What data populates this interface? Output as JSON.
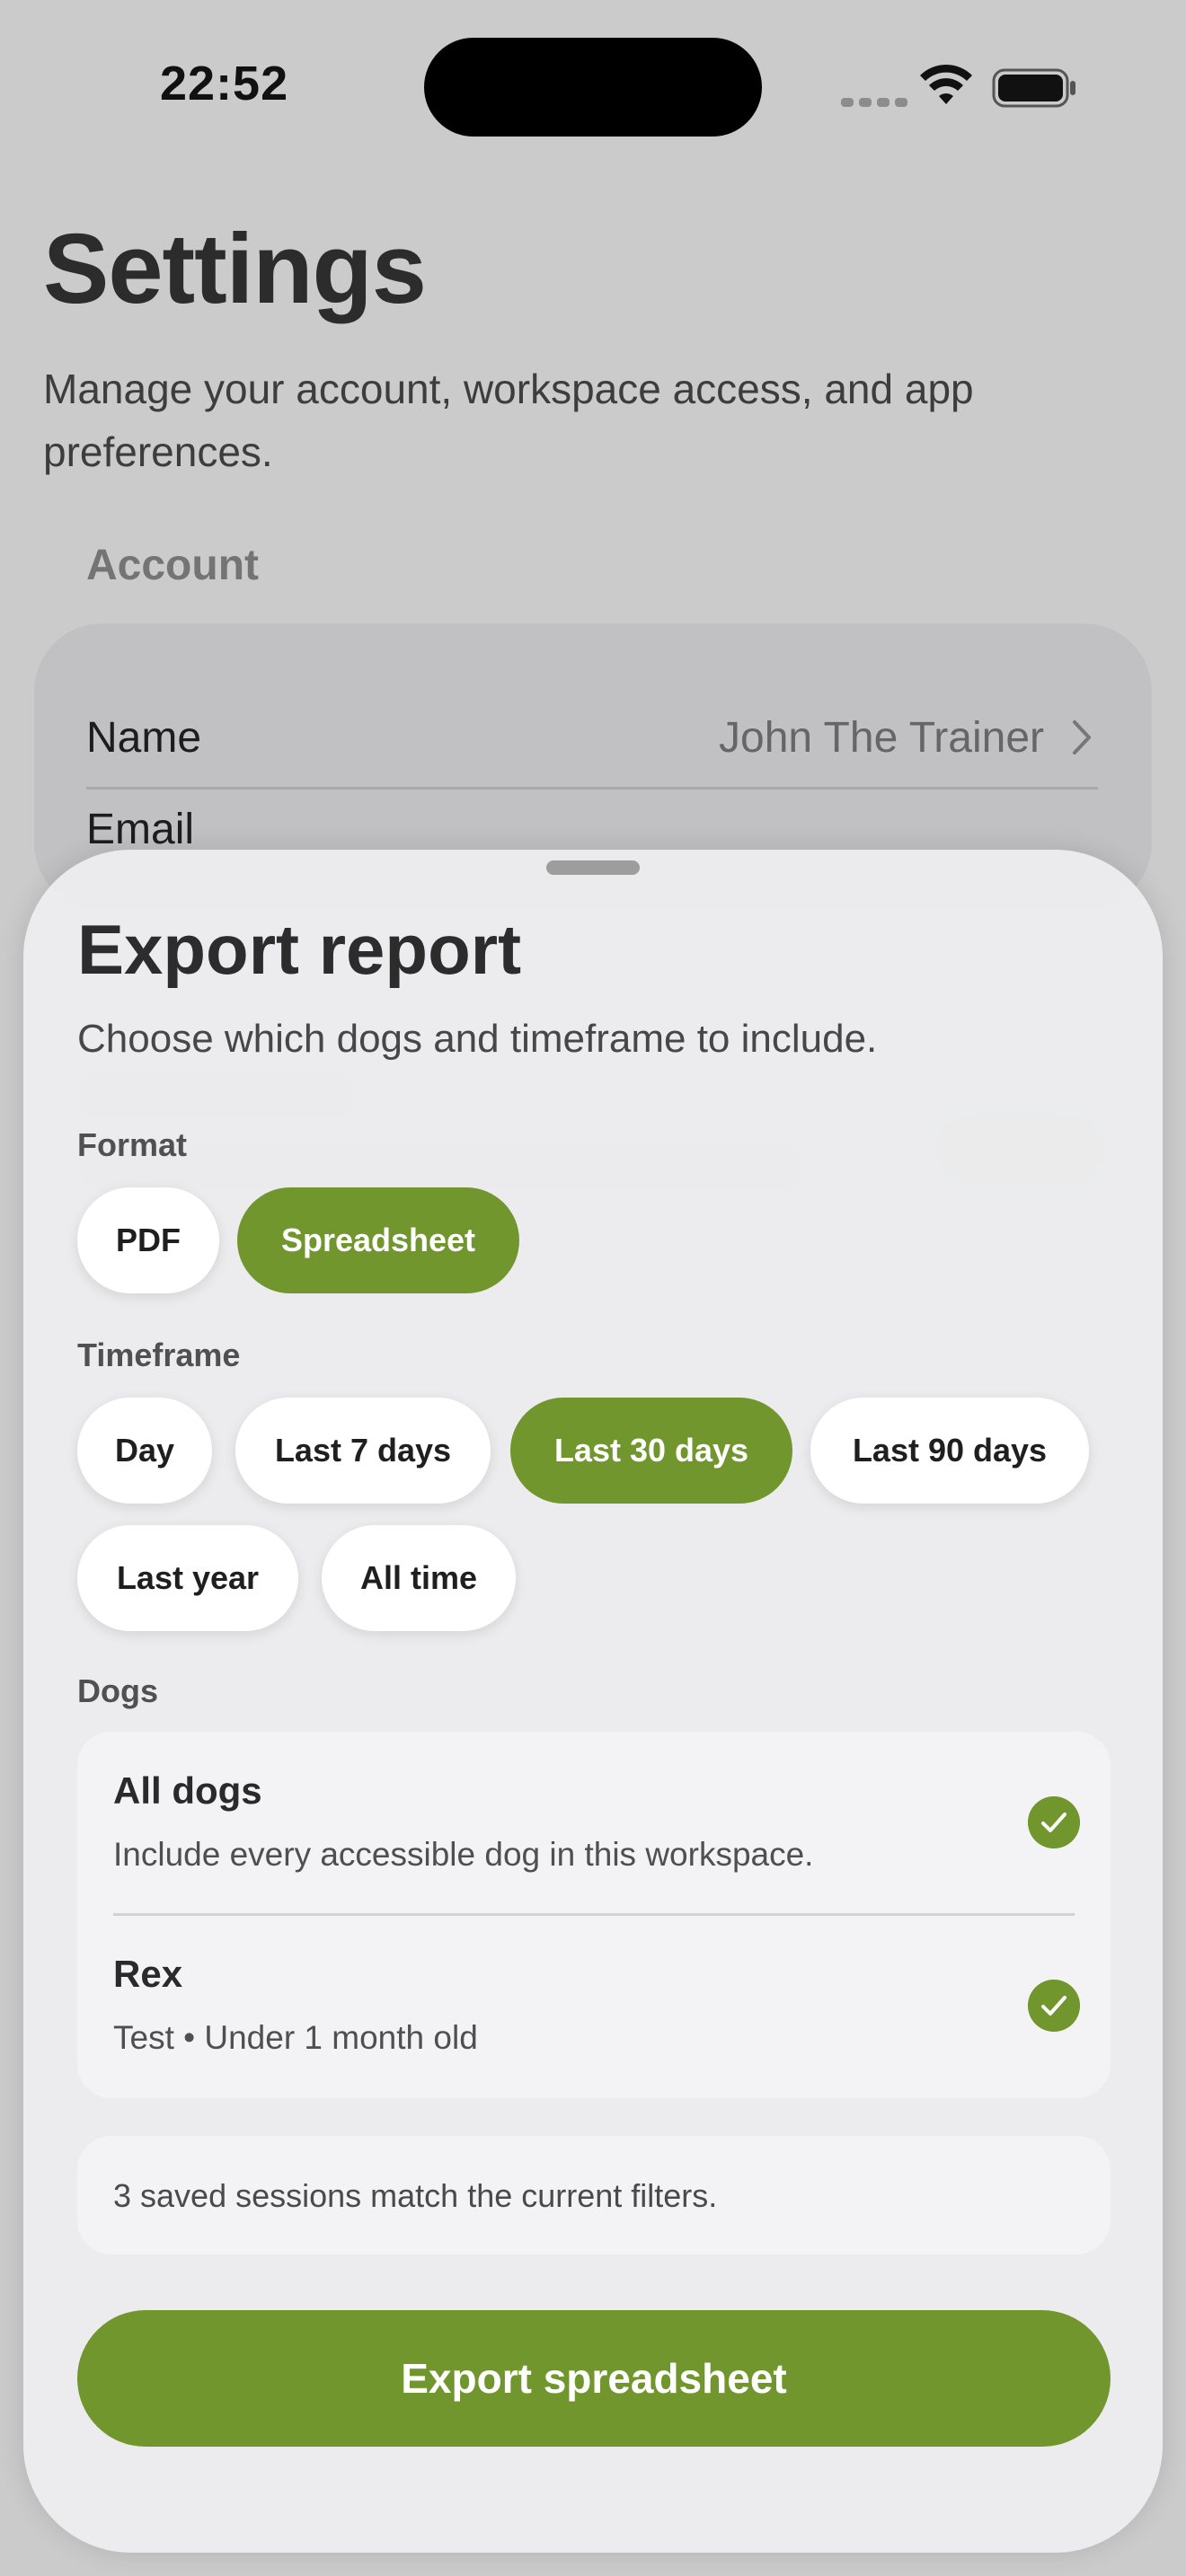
{
  "status_bar": {
    "time": "22:52"
  },
  "settings": {
    "title": "Settings",
    "subtitle": "Manage your account, workspace access, and app preferences.",
    "account_section": "Account",
    "rows": [
      {
        "label": "Name",
        "value": "John The Trainer"
      },
      {
        "label": "Email"
      }
    ]
  },
  "sheet": {
    "title": "Export report",
    "subtitle": "Choose which dogs and timeframe to include.",
    "format": {
      "label": "Format",
      "options": [
        "PDF",
        "Spreadsheet"
      ],
      "selected": "Spreadsheet"
    },
    "timeframe": {
      "label": "Timeframe",
      "options": [
        "Day",
        "Last 7 days",
        "Last 30 days",
        "Last 90 days",
        "Last year",
        "All time"
      ],
      "selected": "Last 30 days"
    },
    "dogs": {
      "label": "Dogs",
      "items": [
        {
          "title": "All dogs",
          "subtitle": "Include every accessible dog in this workspace.",
          "checked": true
        },
        {
          "title": "Rex",
          "subtitle": "Test • Under 1 month old",
          "checked": true
        }
      ]
    },
    "summary": "3 saved sessions match the current filters.",
    "export_button": "Export spreadsheet"
  },
  "colors": {
    "accent": "#72962e",
    "sheet_background": "#ececee",
    "card_background": "#f3f3f5"
  }
}
